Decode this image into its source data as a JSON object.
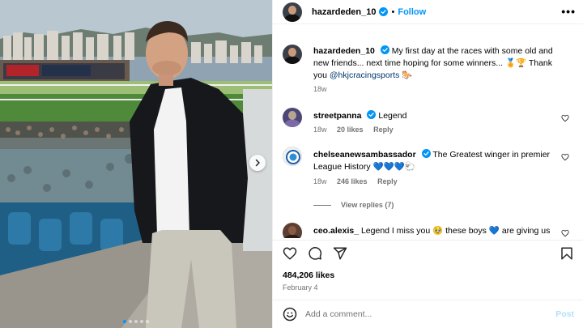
{
  "header": {
    "username": "hazardeden_10",
    "separator": "•",
    "follow_label": "Follow",
    "more_label": "•••"
  },
  "caption": {
    "username": "hazardeden_10",
    "text_before": "My first day at the races with some old and new friends... next time hoping for some winners...",
    "emojis_mid": "🏅🏆",
    "text_after": "Thank you",
    "mention": "@hkjcracingsports",
    "emoji_end": "🐎",
    "time": "18w"
  },
  "comments": [
    {
      "username": "streetpanna",
      "text": "Legend",
      "time": "18w",
      "likes": "20 likes",
      "reply": "Reply"
    },
    {
      "username": "chelseanewsambassador",
      "text": "The Greatest winger in premier League History",
      "emoji": "💙💙💙🐑",
      "time": "18w",
      "likes": "246 likes",
      "reply": "Reply"
    },
    {
      "username": "ceo.alexis_",
      "text_before": "Legend I miss you",
      "emoji": "🥹",
      "text_mid": "these boys",
      "emoji2": "💙",
      "text_after": "are giving us"
    }
  ],
  "view_replies": "View replies (7)",
  "likes": "484,206 likes",
  "date": "February 4",
  "add_comment": {
    "placeholder": "Add a comment...",
    "post_label": "Post"
  },
  "icons": {
    "like": "heart-icon",
    "comment": "comment-icon",
    "share": "share-icon",
    "save": "bookmark-icon",
    "emoji": "smiley-icon",
    "verified": "verified-badge-icon",
    "next": "chevron-right-icon"
  },
  "colors": {
    "accent": "#0095f6",
    "muted": "#737373",
    "verified": "#0095f6",
    "mention": "#00376b"
  },
  "carousel": {
    "total": 5,
    "active_index": 0
  }
}
